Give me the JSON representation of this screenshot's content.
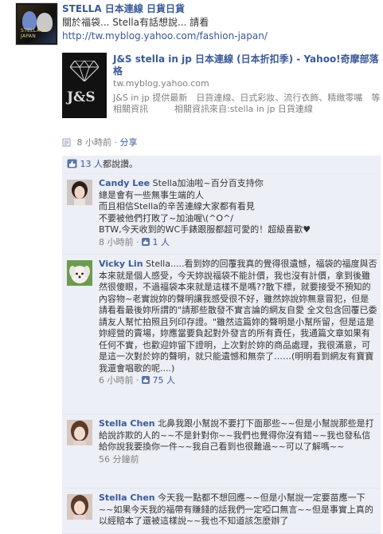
{
  "post": {
    "author": "STELLA 日本連線 日貨日貨",
    "message": "關於福袋... Stella有話想說... 請看",
    "url": "http://tw.myblog.yahoo.com/fashion-japan/",
    "avatar_caption": "STELLA IN JAPAN"
  },
  "preview": {
    "title": "J&S stella in jp 日本連線 (日本折扣季) - Yahoo!奇摩部落格",
    "domain": "tw.myblog.yahoo.com",
    "description": "J&S in jp 提供最新　日貨連線、日式彩妝、流行衣飾、精緻零嘴　等相關資訊　　　相關資訊來自:stella in jp 日貨連線",
    "logo_text": "J&S"
  },
  "meta": {
    "time": "8 小時前",
    "separator": "·",
    "share_label": "分享"
  },
  "likes": {
    "count_label": "13 人",
    "suffix": "都說讚。"
  },
  "comments": [
    {
      "author": "Candy Lee",
      "text": "Stella加油啦~百分百支持你\n總是會有一些無事生端的人\n而且相信Stella的辛苦連線大家都有看見\n不要被他們打敗了~加油喔\\(^O^/\nBTW,今天收到的WC手錶跟服都超可愛的！超級喜歡♥",
      "time": "8 小時前",
      "like_label": "1 人"
    },
    {
      "author": "Vicky Lin",
      "text": "Stella.....看到妳的回覆我真的覺得很遺憾，福袋的福度與否本來就是個人感受，今天妳說福袋不能計價，我也沒有計價，拿到後雖然很傻眼，不過福袋本來就是這樣不是嗎??散下標，就要接受不預知的內容物~老實說妳的聲明讓我感受很不好，雖然妳說妳無意冒犯，但是請看看最後妳所謂的\"請那些散發不實言論的網友自愛 全文包含回覆已委請友人幫忙拍照且列印存證。\"雖然這篇妳的聲明是小幫所留，但是這是妳經營的賣場，妳應當要負起對外發言的所有責任，我通篇文章如果有任何不實，也歡迎妳留下證明，上次對於妳的商品處理，我很滿意，可是這一次對於妳的聲明，就只能遺憾和無奈了……(明明看到網友有寶寶我還會唱歌的呢....)",
      "time": "6 小時前",
      "like_label": "75 人"
    },
    {
      "author": "Stella Chen",
      "text": "北鼻我跟小幫說不要打下面那些~~但是小幫說那些是打給說詐欺的人的~~不是針對你~~我們也覺得你沒有錯~~我也發私信給你說我要換你一件~~我自己看到也很難過~~可以了解嗎~~",
      "time": "56 分鐘前"
    },
    {
      "author": "Stella Chen",
      "text": "今天我一點都不想回應~~但是小幫說一定要苗應一下~~如果今天我的福帶有賺錢的話我們一定啞口無言~~但是事實上真的以經賠本了還被這樣說~~我也不知道該怎麼辦了"
    }
  ],
  "colors": {
    "link": "#3b5998",
    "comment_bg": "#eceff5",
    "meta_text": "#808080"
  }
}
